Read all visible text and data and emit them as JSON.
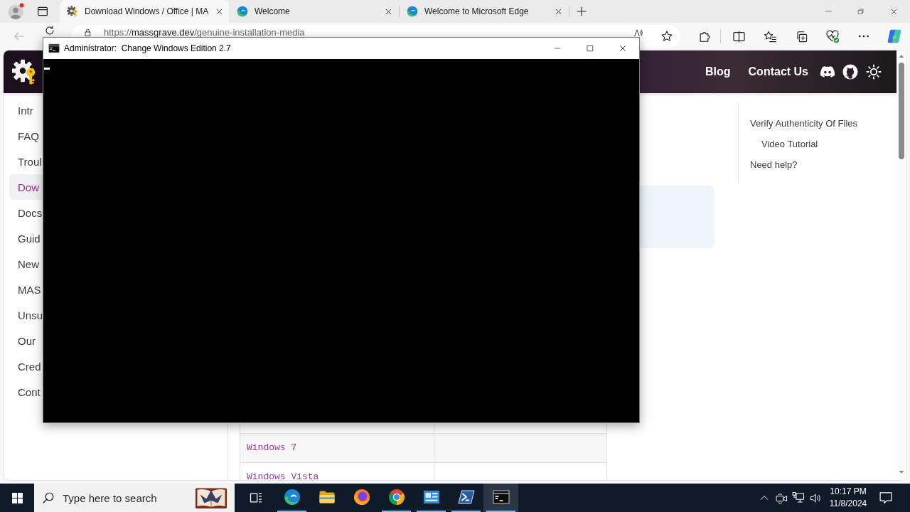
{
  "browser": {
    "tabs": [
      {
        "title": "Download Windows / Office | MA",
        "selected": true
      },
      {
        "title": "Welcome",
        "selected": false
      },
      {
        "title": "Welcome to Microsoft Edge",
        "selected": false
      }
    ],
    "back": {
      "disabled": true
    },
    "address": {
      "scheme": "https://",
      "host": "massgrave.dev",
      "path": "/genuine-installation-media"
    }
  },
  "site_header": {
    "nav": [
      "Blog",
      "Contact Us"
    ]
  },
  "sidebar": {
    "items": [
      {
        "label": "Intr",
        "selected": false
      },
      {
        "label": "FAQ",
        "selected": false
      },
      {
        "label": "Troul",
        "selected": false
      },
      {
        "label": "Dow",
        "selected": true
      },
      {
        "label": "Docs",
        "selected": false
      },
      {
        "label": "Guid",
        "selected": false
      },
      {
        "label": "New",
        "selected": false
      },
      {
        "label": "MAS",
        "selected": false
      },
      {
        "label": "Unsu",
        "selected": false
      },
      {
        "label": "Our",
        "selected": false
      },
      {
        "label": "Cred",
        "selected": false
      },
      {
        "label": "Cont",
        "selected": false
      }
    ]
  },
  "table": {
    "rows": [
      "Windows 7",
      "Windows Vista"
    ]
  },
  "outline": {
    "items": [
      {
        "label": "Verify Authenticity Of Files",
        "children": [
          {
            "label": "Video Tutorial"
          }
        ]
      },
      {
        "label": "Need help?"
      }
    ]
  },
  "console": {
    "title": "Administrator:  Change Windows Edition 2.7"
  },
  "taskbar": {
    "search": {
      "placeholder": "Type here to search"
    },
    "apps": [
      {
        "running": true,
        "selected": false
      },
      {
        "running": false,
        "selected": false
      },
      {
        "running": false,
        "selected": false
      },
      {
        "running": true,
        "selected": false
      },
      {
        "running": true,
        "selected": false
      },
      {
        "running": true,
        "selected": false
      },
      {
        "running": true,
        "selected": true
      }
    ],
    "clock": {
      "time": "10:17 PM",
      "date": "11/8/2024"
    }
  }
}
